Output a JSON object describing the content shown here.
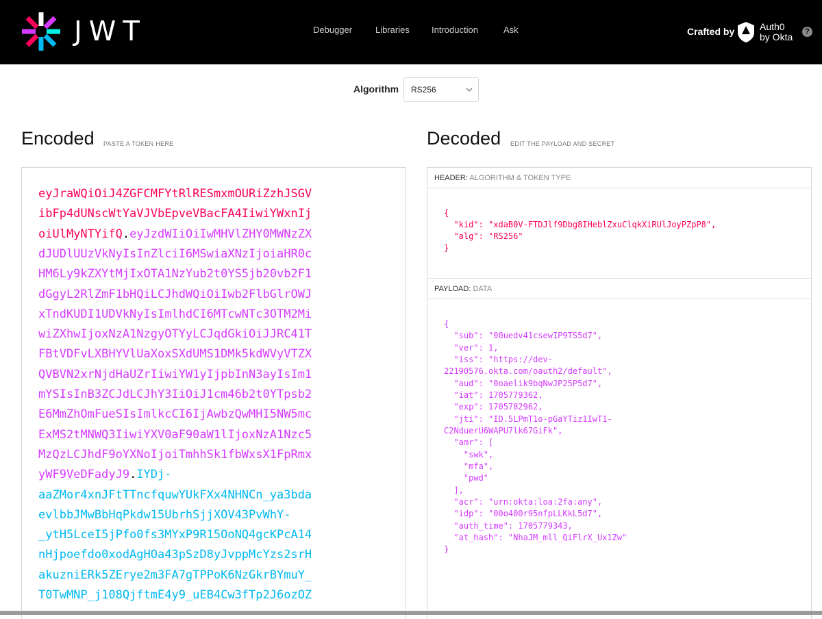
{
  "header": {
    "logo_text": "JWT",
    "nav": [
      {
        "label": "Debugger"
      },
      {
        "label": "Libraries"
      },
      {
        "label": "Introduction"
      },
      {
        "label": "Ask"
      }
    ],
    "crafted_by": "Crafted by",
    "partner": "Auth0\nby Okta",
    "help": "?"
  },
  "algorithm": {
    "label": "Algorithm",
    "selected": "RS256"
  },
  "encoded": {
    "title": "Encoded",
    "subtitle": "PASTE A TOKEN HERE",
    "lines": [
      [
        {
          "c": "hdr",
          "t": "eyJraWQiOiJ4ZGFCMFYtRlRESmxmOURiZzhJSGV"
        }
      ],
      [
        {
          "c": "hdr",
          "t": "ibFp4dUNscWtYaVJVbEpveVBacFA4IiwiYWxnIj"
        }
      ],
      [
        {
          "c": "hdr",
          "t": "oiUlMyNTYifQ"
        },
        {
          "c": "dot",
          "t": "."
        },
        {
          "c": "pl",
          "t": "eyJzdWIiOiIwMHVlZHY0MWNzZX"
        }
      ],
      [
        {
          "c": "pl",
          "t": "dJUDlUUzVkNyIsInZlciI6MSwiaXNzIjoiaHR0c"
        }
      ],
      [
        {
          "c": "pl",
          "t": "HM6Ly9kZXYtMjIxOTA1NzYub2t0YS5jb20vb2F1"
        }
      ],
      [
        {
          "c": "pl",
          "t": "dGgyL2RlZmF1bHQiLCJhdWQiOiIwb2FlbGlrOWJ"
        }
      ],
      [
        {
          "c": "pl",
          "t": "xTndKUDI1UDVkNyIsImlhdCI6MTcwNTc3OTM2Mi"
        }
      ],
      [
        {
          "c": "pl",
          "t": "wiZXhwIjoxNzA1NzgyOTYyLCJqdGkiOiJJRC41T"
        }
      ],
      [
        {
          "c": "pl",
          "t": "FBtVDFvLXBHYVlUaXoxSXdUMS1DMk5kdWVyVTZX"
        }
      ],
      [
        {
          "c": "pl",
          "t": "QVBVN2xrNjdHaUZrIiwiYW1yIjpbInN3ayIsIm1"
        }
      ],
      [
        {
          "c": "pl",
          "t": "mYSIsInB3ZCJdLCJhY3IiOiJ1cm46b2t0YTpsb2"
        }
      ],
      [
        {
          "c": "pl",
          "t": "E6MmZhOmFueSIsImlkcCI6IjAwbzQwMHI5NW5mc"
        }
      ],
      [
        {
          "c": "pl",
          "t": "ExMS2tMNWQ3IiwiYXV0aF90aW1lIjoxNzA1Nzc5"
        }
      ],
      [
        {
          "c": "pl",
          "t": "MzQzLCJhdF9oYXNoIjoiTmhhSk1fbWxsX1FpRmx"
        }
      ],
      [
        {
          "c": "pl",
          "t": "yWF9VeDFadyJ9"
        },
        {
          "c": "dot",
          "t": "."
        },
        {
          "c": "sig",
          "t": "IYDj-"
        }
      ],
      [
        {
          "c": "sig",
          "t": "aaZMor4xnJFtTTncfquwYUkFXx4NHNCn_ya3bda"
        }
      ],
      [
        {
          "c": "sig",
          "t": "evlbbJMwBbHqPkdw15UbrhSjjXOV43PvWhY-"
        }
      ],
      [
        {
          "c": "sig",
          "t": "_ytH5LceI5jPfo0fs3MYxP9R15OoNQ4gcKPcA14"
        }
      ],
      [
        {
          "c": "sig",
          "t": "nHjpoefdo0xodAgHOa43pSzD8yJvppMcYzs2srH"
        }
      ],
      [
        {
          "c": "sig",
          "t": "akuzniERk5ZErye2m3FA7gTPPoK6NzGkrBYmuY_"
        }
      ],
      [
        {
          "c": "sig",
          "t": "T0TwMNP_j108QjftmE4y9_uEB4Cw3fTp2J6ozOZ"
        }
      ]
    ]
  },
  "decoded": {
    "title": "Decoded",
    "subtitle": "EDIT THE PAYLOAD AND SECRET",
    "header_section": {
      "label": "HEADER:",
      "sublabel": "ALGORITHM & TOKEN TYPE",
      "code": "{\n  \"kid\": \"xdaB0V-FTDJlf9Dbg8IHeblZxuClqkXiRUlJoyPZpP8\",\n  \"alg\": \"RS256\"\n}"
    },
    "payload_section": {
      "label": "PAYLOAD:",
      "sublabel": "DATA",
      "code": "{\n  \"sub\": \"00uedv41csewIP9TS5d7\",\n  \"ver\": 1,\n  \"iss\": \"https://dev-\n22190576.okta.com/oauth2/default\",\n  \"aud\": \"0oaelik9bqNwJP25P5d7\",\n  \"iat\": 1705779362,\n  \"exp\": 1705782962,\n  \"jti\": \"ID.5LPmT1o-pGaYTiz1IwT1-\nC2NduerU6WAPU7lk67GiFk\",\n  \"amr\": [\n    \"swk\",\n    \"mfa\",\n    \"pwd\"\n  ],\n  \"acr\": \"urn:okta:loa:2fa:any\",\n  \"idp\": \"00o400r95nfpLLKkL5d7\",\n  \"auth_time\": 1705779343,\n  \"at_hash\": \"NhaJM_mll_QiFlrX_Ux1Zw\"\n}"
    }
  },
  "colors": {
    "header_part": "#fb015b",
    "payload_part": "#d63aff",
    "signature_part": "#00b9f1",
    "topbar": "#000000"
  }
}
